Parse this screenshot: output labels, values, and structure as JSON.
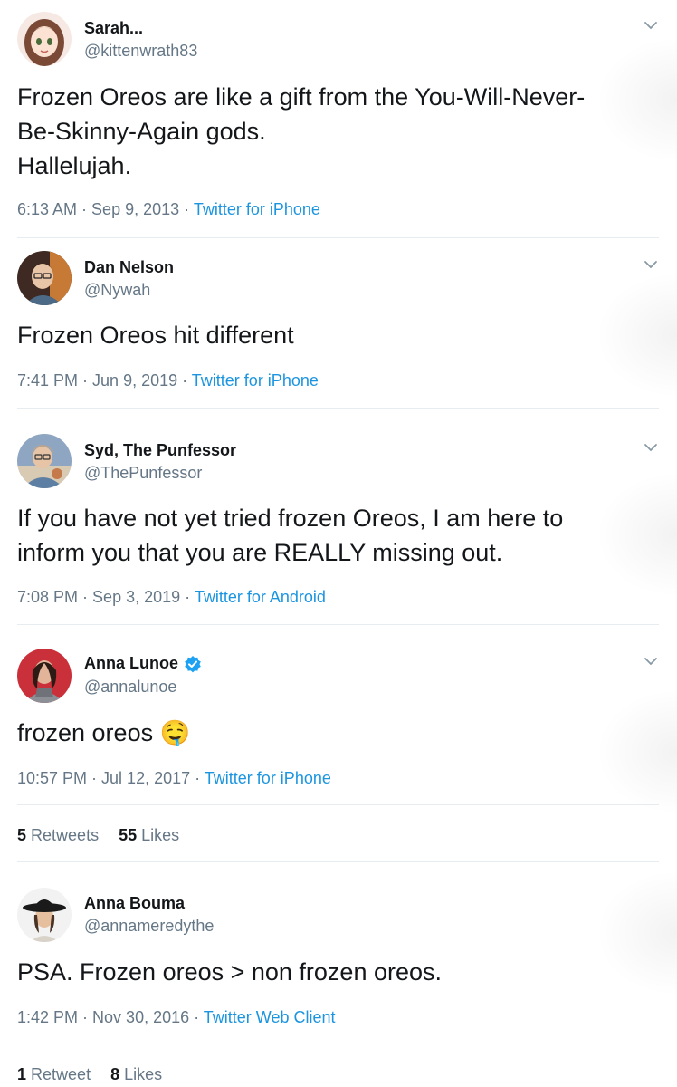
{
  "tweets": [
    {
      "name": "Sarah...",
      "handle": "@kittenwrath83",
      "verified": false,
      "text": "Frozen Oreos are like a gift from the You-Will-Never-\nBe-Skinny-Again gods.\nHallelujah.",
      "time": "6:13 AM",
      "date": "Sep 9, 2013",
      "source": "Twitter for iPhone"
    },
    {
      "name": "Dan Nelson",
      "handle": "@Nywah",
      "verified": false,
      "text": "Frozen Oreos hit different",
      "time": "7:41 PM",
      "date": "Jun 9, 2019",
      "source": "Twitter for iPhone"
    },
    {
      "name": "Syd, The Punfessor",
      "handle": "@ThePunfessor",
      "verified": false,
      "text": "If you have not yet tried frozen Oreos, I am here to\ninform you that you are REALLY missing out.",
      "time": "7:08 PM",
      "date": "Sep 3, 2019",
      "source": "Twitter for Android"
    },
    {
      "name": "Anna Lunoe",
      "handle": "@annalunoe",
      "verified": true,
      "text": "frozen oreos 🤤",
      "time": "10:57 PM",
      "date": "Jul 12, 2017",
      "source": "Twitter for iPhone",
      "retweets": "5",
      "retweets_label": "Retweets",
      "likes": "55",
      "likes_label": "Likes"
    },
    {
      "name": "Anna Bouma",
      "handle": "@annameredythe",
      "verified": false,
      "text": "PSA. Frozen oreos > non frozen oreos.",
      "time": "1:42 PM",
      "date": "Nov 30, 2016",
      "source": "Twitter Web Client",
      "retweets": "1",
      "retweets_label": "Retweet",
      "likes": "8",
      "likes_label": "Likes"
    }
  ],
  "separator": " · ",
  "icons": {
    "menu": "chevron-down-icon",
    "verified": "verified-badge-icon"
  },
  "colors": {
    "link": "#1b95e0",
    "muted": "#657786",
    "text": "#14171a",
    "verified": "#1da1f2"
  }
}
